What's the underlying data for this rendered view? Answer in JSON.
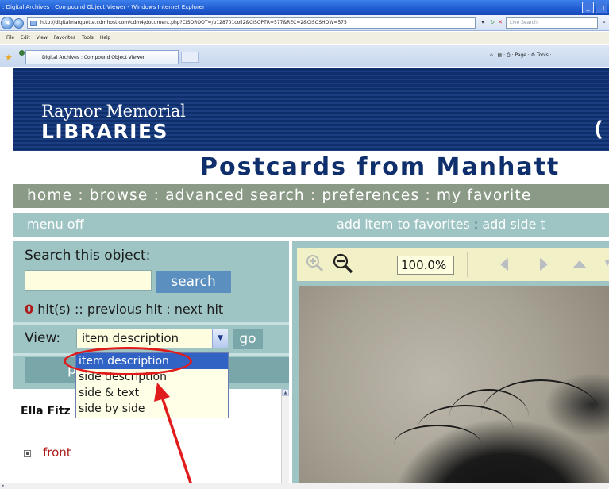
{
  "browser": {
    "window_title": ": Digital Archives : Compound Object Viewer - Windows Internet Explorer",
    "url": "http://digitalmarquette.cdmhost.com/cdm4/document.php?CISOROOT=/p128701coll2&CISOPTR=577&REC=2&CISOSHOW=575",
    "search_placeholder": "Live Search",
    "menu": [
      "File",
      "Edit",
      "View",
      "Favorites",
      "Tools",
      "Help"
    ],
    "tab_title": "Digital Archives : Compound Object Viewer",
    "command_bar": "⌂ ·  ▤  ·  ⎙ ·  Page ·  ⚙ Tools ·"
  },
  "banner": {
    "logo_line1": "Raynor Memorial",
    "logo_line2": "LIBRARIES",
    "edge_glyph": "("
  },
  "page": {
    "title": "Postcards from Manhatt"
  },
  "nav": {
    "items": [
      "home",
      "browse",
      "advanced search",
      "preferences",
      "my favorite"
    ],
    "separator": " : "
  },
  "menubar": {
    "menu_off": "menu off",
    "add_favorites": "add item to favorites",
    "separator": " : ",
    "add_side": "add side t"
  },
  "search": {
    "label": "Search this object:",
    "input_value": "",
    "button": "search",
    "hit_count": "0",
    "hits_text": " hit(s) :: previous hit : next hit"
  },
  "view": {
    "label": "View:",
    "selected": "item description",
    "go": "go",
    "options": [
      "item description",
      "side description",
      "side & text",
      "side by side"
    ],
    "highlighted_index": 0
  },
  "sides": {
    "bar_text": "pr                            side"
  },
  "item": {
    "title": "Ella Fitz",
    "front_link": "front"
  },
  "viewer": {
    "zoom_value": "100.0%"
  },
  "colors": {
    "banner_blue": "#0e2e6c",
    "nav_gray": "#8b9a86",
    "panel_teal": "#9ec4c4",
    "annotation_red": "#e01b1b"
  }
}
